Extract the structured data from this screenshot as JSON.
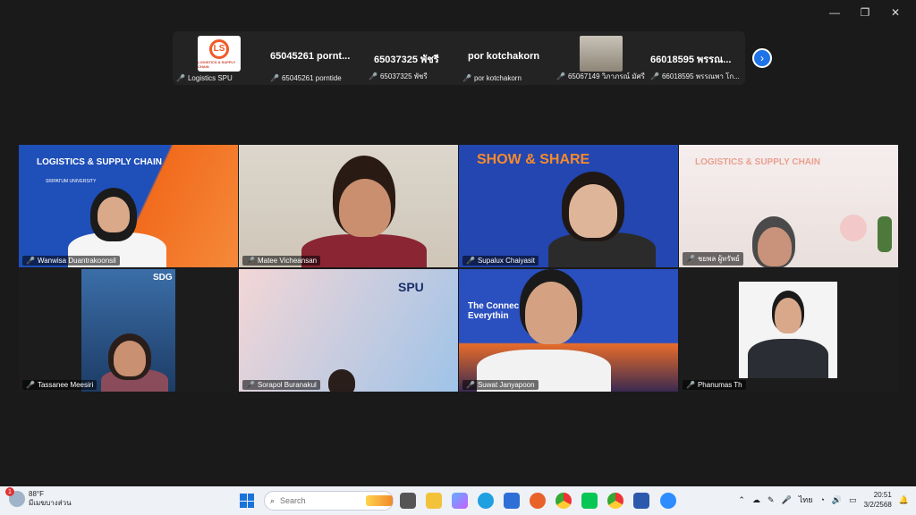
{
  "window": {
    "controls": [
      "—",
      "❐",
      "✕"
    ]
  },
  "strip": {
    "tiles": [
      {
        "name": "",
        "label": "Logistics SPU"
      },
      {
        "name": "65045261 porntide",
        "name_display": "65045261 pornt...",
        "label": "65045261 porntide"
      },
      {
        "name_display": "65037325 พัชรี",
        "label": "65037325 พัชรี"
      },
      {
        "name_display": "por kotchakorn",
        "label": "por kotchakorn"
      },
      {
        "name_display": "",
        "label": "65067149 วิภาภรณ์ มัศรี"
      },
      {
        "name_display": "66018595 พรรณ...",
        "label": "66018595 พรรณพา โก..."
      }
    ],
    "logo_text": "LOGISTICS & SUPPLY CHAIN"
  },
  "grid": {
    "tiles": [
      {
        "label": "Wanwisa Duantrakoonsil",
        "banner": "LOGISTICS & SUPPLY CHAIN",
        "sub": "SRIPATUM UNIVERSITY"
      },
      {
        "label": "Matee Vicheansan"
      },
      {
        "label": "Supalux Chaiyasit",
        "banner": "SHOW & SHARE"
      },
      {
        "label": "ชยพล ผู้ทรัพย์",
        "banner": "LOGISTICS & SUPPLY CHAIN"
      },
      {
        "label": "Tassanee Meesiri",
        "banner": "SDG"
      },
      {
        "label": "Sorapol Buranakul",
        "banner": "SPU"
      },
      {
        "label": "Suwat Janyapoon",
        "banner": "The Connec of Everythin"
      },
      {
        "label": "Phanumas Th"
      }
    ]
  },
  "taskbar": {
    "weather": {
      "temp": "88°F",
      "desc": "มีเมฆบางส่วน",
      "badge": "1"
    },
    "search_placeholder": "Search",
    "lang": "ไทย",
    "time": "20:51",
    "date": "3/2/2568"
  }
}
